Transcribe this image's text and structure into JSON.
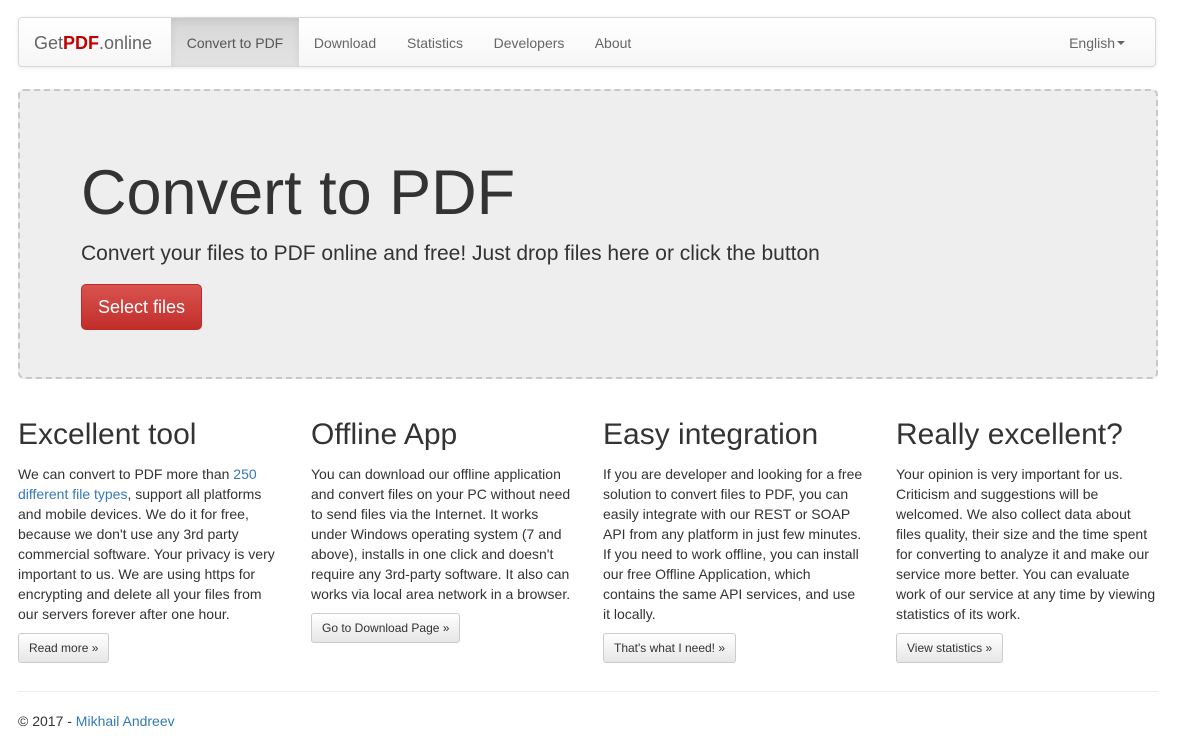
{
  "navbar": {
    "brand_prefix": "Get",
    "brand_pdf": "PDF",
    "brand_suffix": ".online",
    "items": [
      {
        "label": "Convert to PDF",
        "active": true
      },
      {
        "label": "Download",
        "active": false
      },
      {
        "label": "Statistics",
        "active": false
      },
      {
        "label": "Developers",
        "active": false
      },
      {
        "label": "About",
        "active": false
      }
    ],
    "language": "English"
  },
  "hero": {
    "title": "Convert to PDF",
    "subtitle": "Convert your files to PDF online and free! Just drop files here or click the button",
    "button_label": "Select files"
  },
  "features": [
    {
      "title": "Excellent tool",
      "text_before_link": "We can convert to PDF more than ",
      "link_text": "250 different file types",
      "text_after_link": ", support all platforms and mobile devices. We do it for free, because we don't use any 3rd party commercial software. Your privacy is very important to us. We are using https for encrypting and delete all your files from our servers forever after one hour.",
      "button": "Read more »"
    },
    {
      "title": "Offline App",
      "text": "You can download our offline application and convert files on your PC without need to send files via the Internet. It works under Windows operating system (7 and above), installs in one click and doesn't require any 3rd-party software. It also can works via local area network in a browser.",
      "button": "Go to Download Page »"
    },
    {
      "title": "Easy integration",
      "text": "If you are developer and looking for a free solution to convert files to PDF, you can easily integrate with our REST or SOAP API from any platform in just few minutes. If you need to work offline, you can install our free Offline Application, which contains the same API services, and use it locally.",
      "button": "That's what I need! »"
    },
    {
      "title": "Really excellent?",
      "text": "Your opinion is very important for us. Criticism and suggestions will be welcomed. We also collect data about files quality, their size and the time spent for converting to analyze it and make our service more better. You can evaluate work of our service at any time by viewing statistics of its work.",
      "button": "View statistics »"
    }
  ],
  "footer": {
    "prefix": "© 2017 - ",
    "author": "Mikhail Andreev"
  },
  "colors": {
    "accent_red": "#d9534f",
    "brand_red": "#c40000",
    "link_blue": "#337ab7"
  }
}
